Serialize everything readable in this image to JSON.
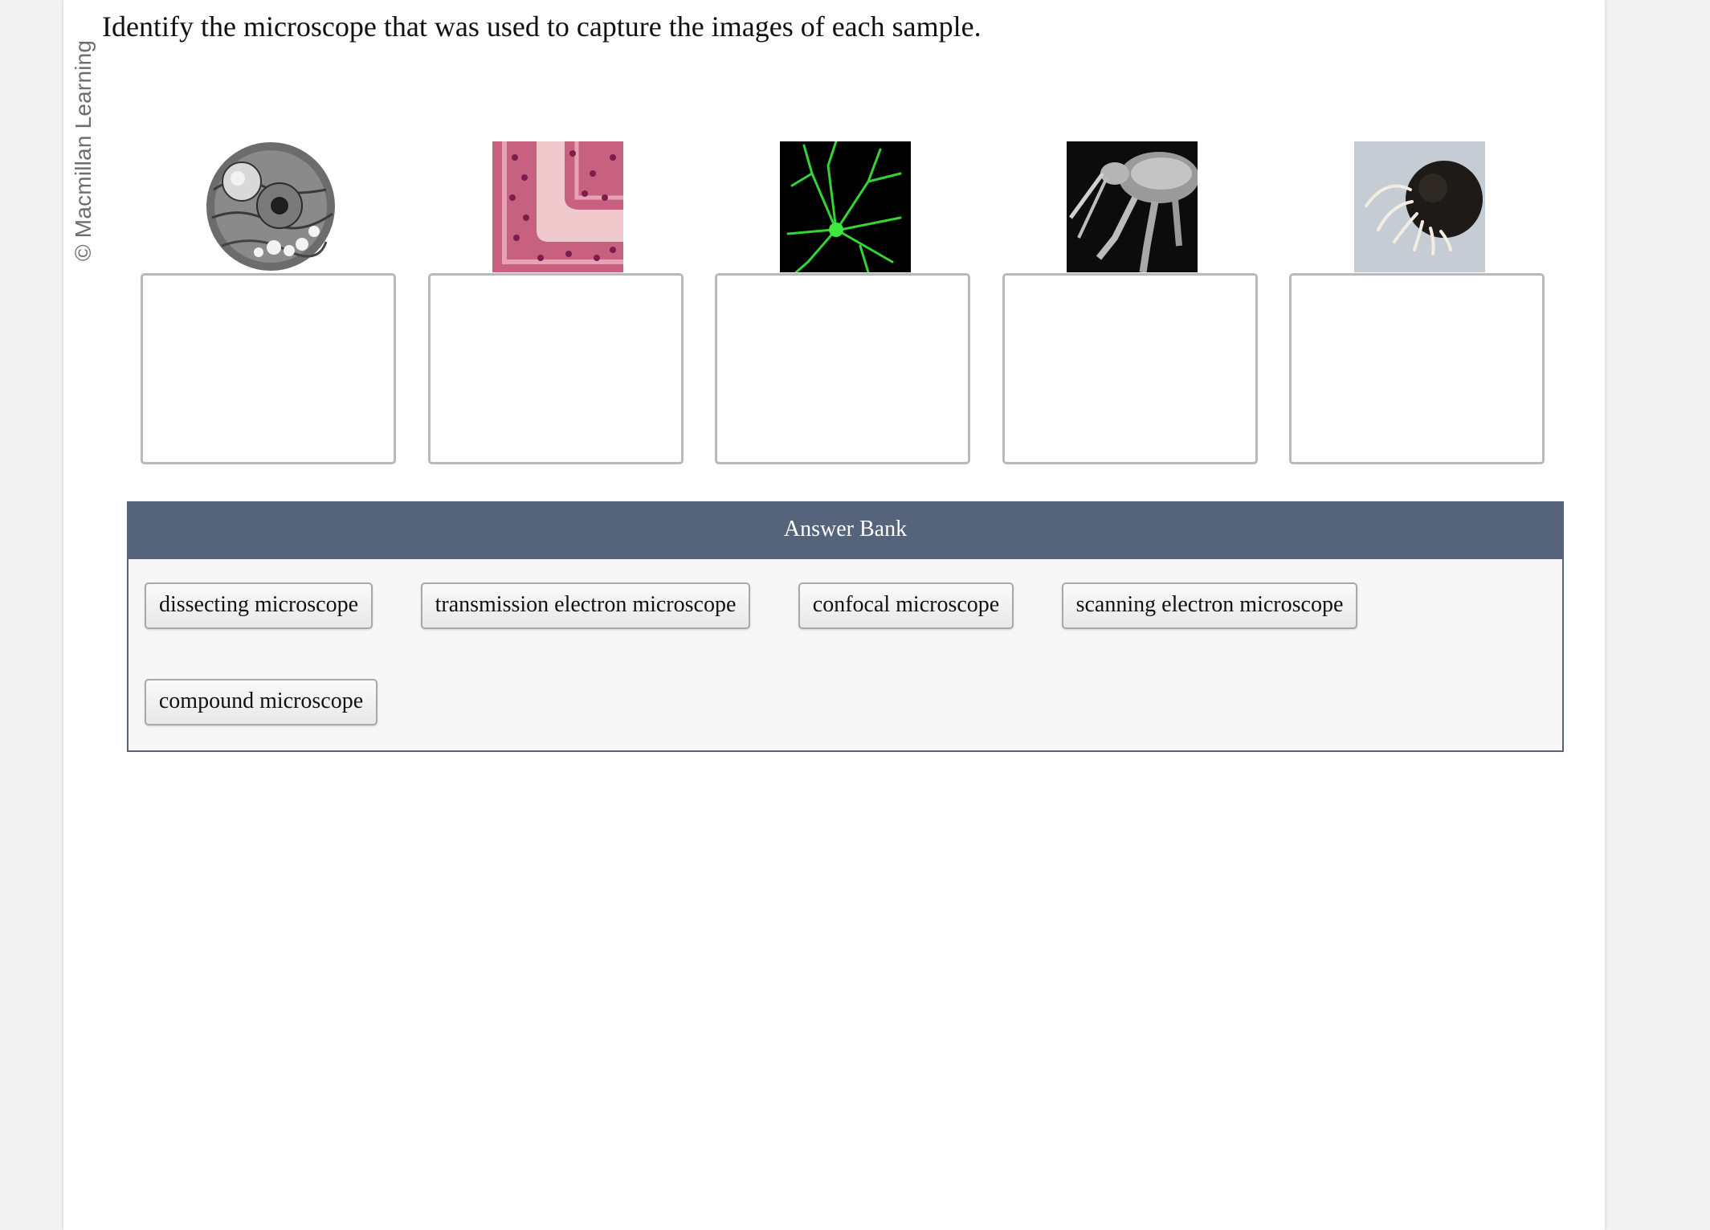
{
  "credit": "© Macmillan Learning",
  "question": "Identify the microscope that was used to capture the images of each sample.",
  "samples": [
    {
      "icon": "tem-cell-image",
      "drop_value": ""
    },
    {
      "icon": "stained-tissue-image",
      "drop_value": ""
    },
    {
      "icon": "fluorescent-neuron-image",
      "drop_value": ""
    },
    {
      "icon": "sem-insect-image",
      "drop_value": ""
    },
    {
      "icon": "whole-organism-image",
      "drop_value": ""
    }
  ],
  "answer_bank": {
    "title": "Answer Bank",
    "items": [
      "dissecting microscope",
      "transmission electron microscope",
      "confocal microscope",
      "scanning electron microscope",
      "compound microscope"
    ]
  },
  "colors": {
    "bank_header": "#55647b",
    "drop_border": "#b9b9b9",
    "background": "#f2f2f2"
  }
}
